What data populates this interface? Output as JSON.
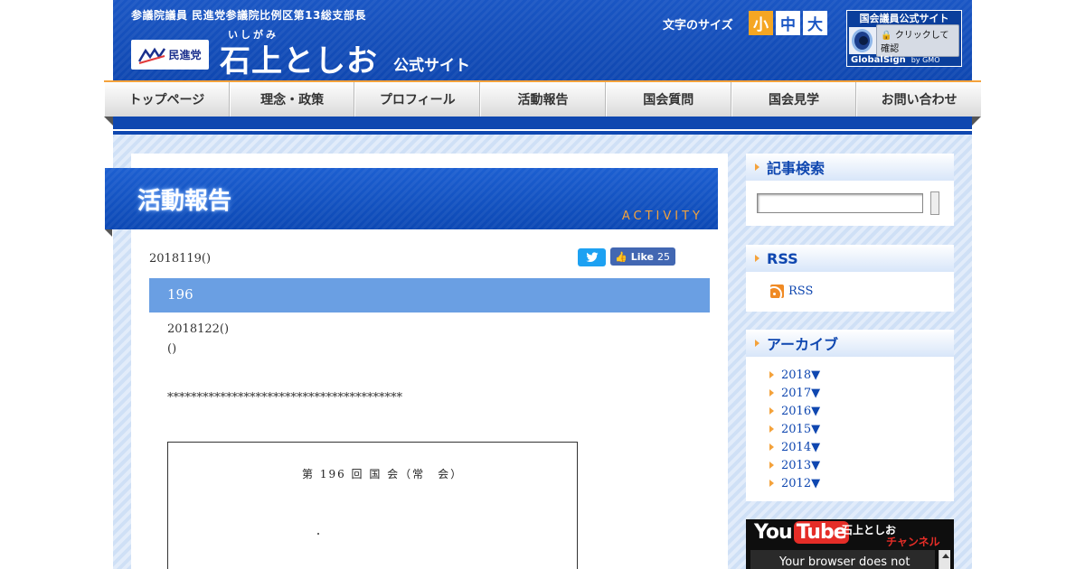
{
  "header": {
    "tagline": "参議院議員 民進党参議院比例区第13総支部長",
    "party_logo_text": "民進党",
    "furigana": "いしがみ",
    "site_name": "石上としお",
    "site_suffix": "公式サイト",
    "font_size_label": "文字のサイズ",
    "font_sizes": [
      "小",
      "中",
      "大"
    ],
    "globalsign": {
      "title": "国会議員公式サイト",
      "button": "クリックして確認",
      "brand": "GlobalSign",
      "by": "by GMO"
    }
  },
  "nav": {
    "items": [
      "トップページ",
      "理念・政策",
      "プロフィール",
      "活動報告",
      "国会質問",
      "国会見学",
      "お問い合わせ"
    ]
  },
  "section": {
    "title": "活動報告",
    "subtitle": "ACTIVITY"
  },
  "post": {
    "date": "2018119()",
    "twitter_icon": "twitter-bird-icon",
    "fb_like_label": "Like",
    "fb_like_count": "25",
    "title": "196",
    "line1": "2018122()",
    "line2": "()",
    "separator": "****************************************",
    "doc_heading": "第 196 回 国 会（常　会）"
  },
  "sidebar": {
    "search": {
      "title": "記事検索"
    },
    "rss": {
      "title": "RSS",
      "link": "RSS"
    },
    "archive": {
      "title": "アーカイブ",
      "years": [
        "2018▼",
        "2017▼",
        "2016▼",
        "2015▼",
        "2014▼",
        "2013▼",
        "2012▼"
      ]
    },
    "youtube": {
      "logo_you": "You",
      "logo_tube": "Tube",
      "name": "石上としお",
      "channel": "チャンネル",
      "message": "Your browser does not"
    }
  },
  "colors": {
    "brand_blue": "#0f47b0",
    "accent_orange": "#f4a23b",
    "title_bar": "#6a9fe3"
  }
}
